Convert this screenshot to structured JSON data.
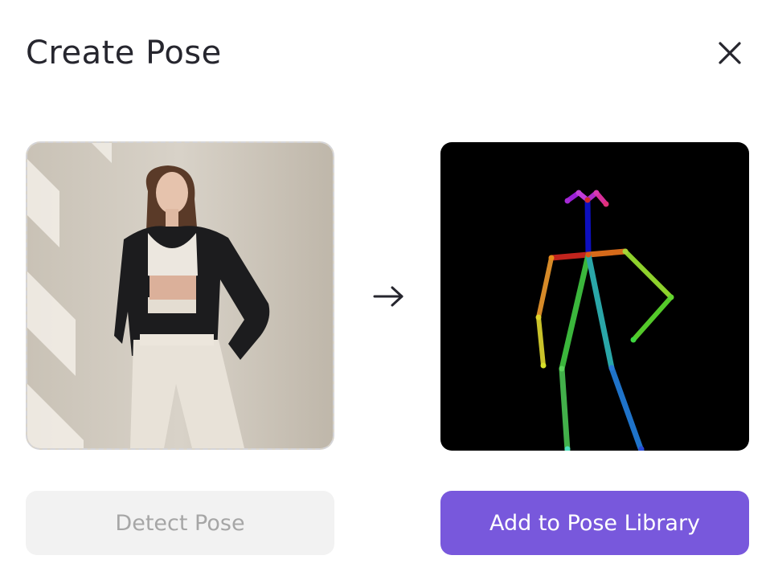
{
  "dialog": {
    "title": "Create Pose",
    "close_icon": "close-icon",
    "arrow_icon": "arrow-right-icon"
  },
  "source_image": {
    "description_icon": "photo-woman-standing"
  },
  "pose_preview": {
    "icon": "openpose-skeleton"
  },
  "buttons": {
    "detect_label": "Detect Pose",
    "add_label": "Add to Pose Library"
  },
  "colors": {
    "accent": "#7858dc",
    "disabled_bg": "#f2f2f2",
    "disabled_text": "#a6a6a6",
    "title_text": "#26262e"
  }
}
